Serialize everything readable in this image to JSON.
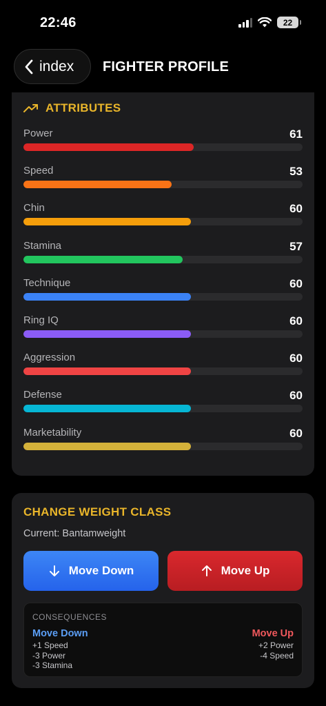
{
  "status": {
    "time": "22:46",
    "battery": "22"
  },
  "nav": {
    "back_label": "index",
    "title": "FIGHTER PROFILE"
  },
  "attributes": {
    "title": "ATTRIBUTES",
    "items": [
      {
        "label": "Power",
        "value": "61",
        "level": 0.61,
        "color": "#dc2626"
      },
      {
        "label": "Speed",
        "value": "53",
        "level": 0.53,
        "color": "#f97316"
      },
      {
        "label": "Chin",
        "value": "60",
        "level": 0.6,
        "color": "#f59e0b"
      },
      {
        "label": "Stamina",
        "value": "57",
        "level": 0.57,
        "color": "#22c55e"
      },
      {
        "label": "Technique",
        "value": "60",
        "level": 0.6,
        "color": "#3b82f6"
      },
      {
        "label": "Ring IQ",
        "value": "60",
        "level": 0.6,
        "color": "#8b5cf6"
      },
      {
        "label": "Aggression",
        "value": "60",
        "level": 0.6,
        "color": "#ef4444"
      },
      {
        "label": "Defense",
        "value": "60",
        "level": 0.6,
        "color": "#06b6d4"
      },
      {
        "label": "Marketability",
        "value": "60",
        "level": 0.6,
        "color": "#d4b13a"
      }
    ]
  },
  "weight_class": {
    "title": "CHANGE WEIGHT CLASS",
    "current": "Current: Bantamweight",
    "move_down_label": "Move Down",
    "move_up_label": "Move Up",
    "consequences": {
      "title": "CONSEQUENCES",
      "down": {
        "title": "Move Down",
        "items": [
          "+1 Speed",
          "-3 Power",
          "-3 Stamina"
        ]
      },
      "up": {
        "title": "Move Up",
        "items": [
          "+2 Power",
          "-4 Speed"
        ]
      }
    }
  }
}
